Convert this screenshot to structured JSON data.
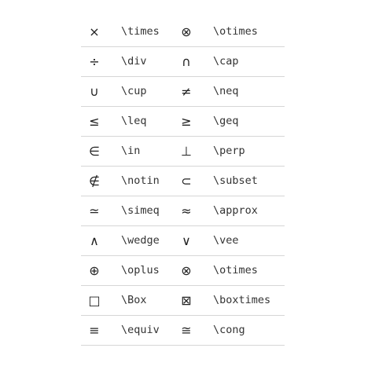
{
  "rows": [
    {
      "sym1": "×",
      "cmd1": "\\times",
      "sym2": "⊗",
      "cmd2": "\\otimes"
    },
    {
      "sym1": "÷",
      "cmd1": "\\div",
      "sym2": "∩",
      "cmd2": "\\cap"
    },
    {
      "sym1": "∪",
      "cmd1": "\\cup",
      "sym2": "≠",
      "cmd2": "\\neq"
    },
    {
      "sym1": "≤",
      "cmd1": "\\leq",
      "sym2": "≥",
      "cmd2": "\\geq"
    },
    {
      "sym1": "∈",
      "cmd1": "\\in",
      "sym2": "⊥",
      "cmd2": "\\perp"
    },
    {
      "sym1": "∉",
      "cmd1": "\\notin",
      "sym2": "⊂",
      "cmd2": "\\subset"
    },
    {
      "sym1": "≃",
      "cmd1": "\\simeq",
      "sym2": "≈",
      "cmd2": "\\approx"
    },
    {
      "sym1": "∧",
      "cmd1": "\\wedge",
      "sym2": "∨",
      "cmd2": "\\vee"
    },
    {
      "sym1": "⊕",
      "cmd1": "\\oplus",
      "sym2": "⊗",
      "cmd2": "\\otimes"
    },
    {
      "sym1": "□",
      "cmd1": "\\Box",
      "sym2": "⊠",
      "cmd2": "\\boxtimes"
    },
    {
      "sym1": "≡",
      "cmd1": "\\equiv",
      "sym2": "≅",
      "cmd2": "\\cong"
    }
  ]
}
